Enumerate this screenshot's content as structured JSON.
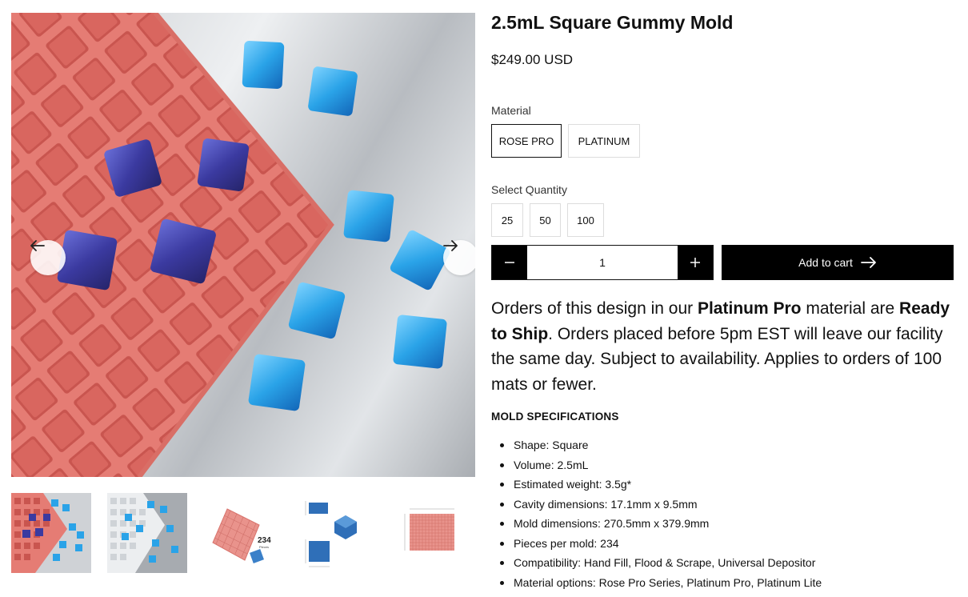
{
  "product": {
    "title": "2.5mL Square Gummy Mold",
    "price": "$249.00 USD"
  },
  "material": {
    "label": "Material",
    "options": [
      "ROSE PRO",
      "PLATINUM"
    ],
    "selected": "ROSE PRO"
  },
  "quantity_select": {
    "label": "Select Quantity",
    "options": [
      "25",
      "50",
      "100"
    ]
  },
  "cart": {
    "quantity_value": "1",
    "add_label": "Add to cart"
  },
  "description": {
    "p1": "Orders of this design in our ",
    "b1": "Platinum Pro",
    "p2": " material are ",
    "b2": "Ready to Ship",
    "p3": ". Orders placed before 5pm EST will leave our facility the same day. Subject to availability. Applies to orders of 100 mats or fewer."
  },
  "specs": {
    "title": "MOLD SPECIFICATIONS",
    "items": [
      "Shape: Square",
      "Volume: 2.5mL",
      "Estimated weight: 3.5g*",
      "Cavity dimensions: 17.1mm x 9.5mm",
      "Mold dimensions: 270.5mm x 379.9mm",
      "Pieces per mold: 234",
      "Compatibility: Hand Fill, Flood & Scrape, Universal Depositor",
      "Material options: Rose Pro Series, Platinum Pro, Platinum Lite"
    ]
  },
  "gallery": {
    "thumb_count_label": "234",
    "thumb_count_sub": "Pieces"
  },
  "colors": {
    "mold_pink": "#e57c74",
    "gummy_blue": "#2aa3e8",
    "button_black": "#000000"
  },
  "icons": {
    "prev": "arrow-left-icon",
    "next": "arrow-right-icon",
    "minus": "minus-icon",
    "plus": "plus-icon",
    "cart_arrow": "arrow-right-icon"
  }
}
